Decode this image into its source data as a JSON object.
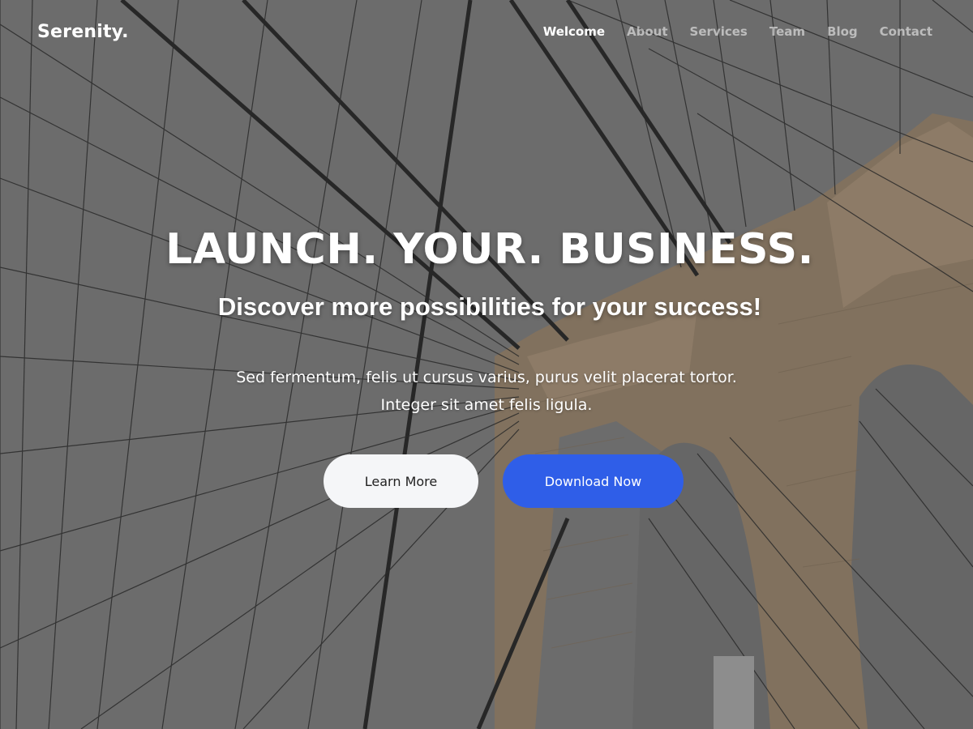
{
  "brand": {
    "name": "Serenity."
  },
  "nav": {
    "items": [
      {
        "label": "Welcome",
        "active": true
      },
      {
        "label": "About",
        "active": false
      },
      {
        "label": "Services",
        "active": false
      },
      {
        "label": "Team",
        "active": false
      },
      {
        "label": "Blog",
        "active": false
      },
      {
        "label": "Contact",
        "active": false
      }
    ]
  },
  "hero": {
    "headline": "LAUNCH. YOUR. BUSINESS.",
    "subheadline": "Discover more possibilities for your success!",
    "description_line1": "Sed fermentum, felis ut cursus varius, purus velit placerat tortor.",
    "description_line2": "Integer sit amet felis ligula.",
    "buttons": {
      "learn_more": "Learn More",
      "download": "Download Now"
    }
  },
  "colors": {
    "primary_button": "#2f5ee8",
    "light_button": "#f5f6f8",
    "overlay": "#6d6d6d",
    "stone": "#a88f72"
  }
}
